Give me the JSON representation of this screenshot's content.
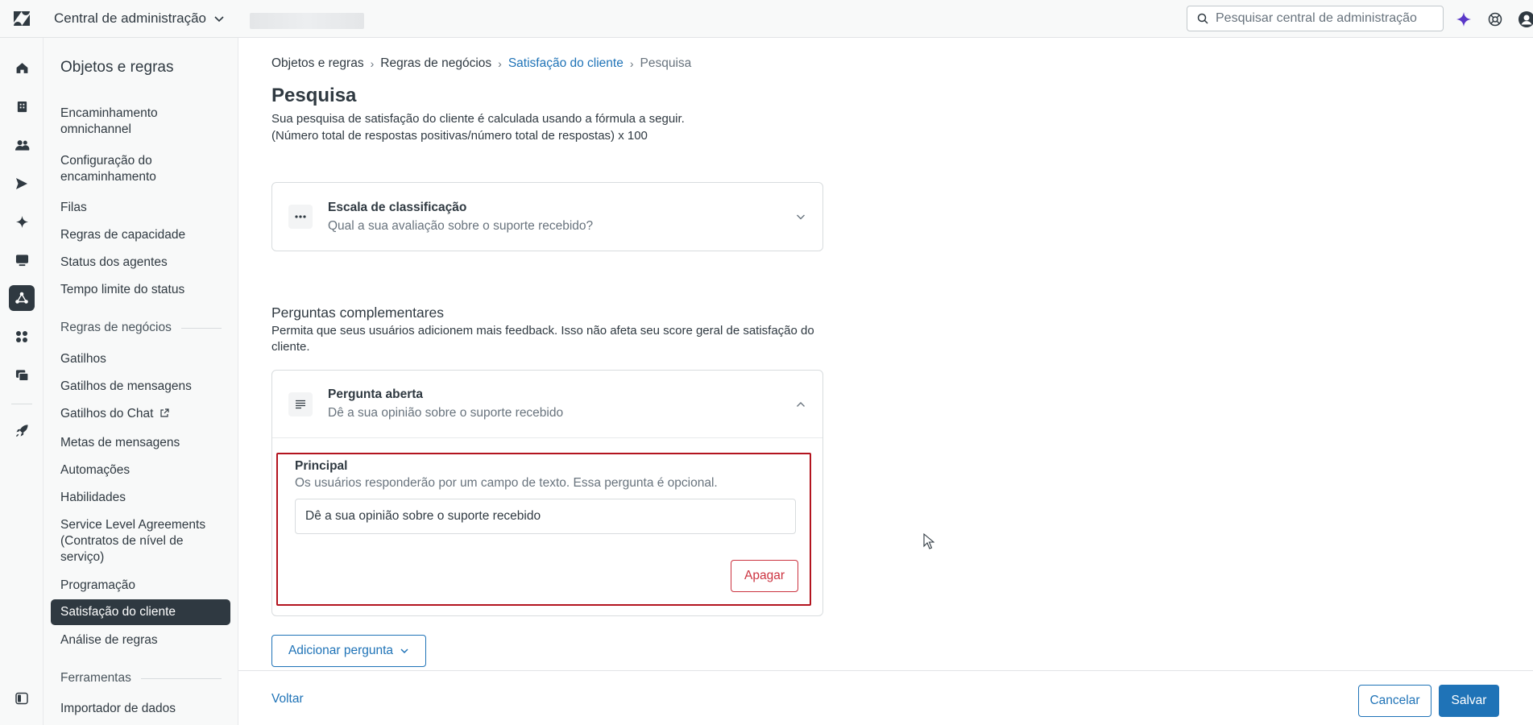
{
  "app": {
    "title": "Central de administração",
    "search_placeholder": "Pesquisar central de administração"
  },
  "colors": {
    "accent": "#1f73b7",
    "danger": "#cc3340",
    "highlight_border": "#b3141f",
    "active_nav": "#2f3941",
    "ai_sparkle": "#5a38c8"
  },
  "subnav": {
    "title": "Objetos e regras",
    "group_routing_items": [
      "Encaminhamento omnichannel",
      "Configuração do encaminhamento",
      "Filas",
      "Regras de capacidade",
      "Status dos agentes",
      "Tempo limite do status"
    ],
    "group_business": "Regras de negócios",
    "business_items": [
      "Gatilhos",
      "Gatilhos de mensagens",
      "Gatilhos do Chat",
      "Metas de mensagens",
      "Automações",
      "Habilidades",
      "Service Level Agreements (Contratos de nível de serviço)",
      "Programação",
      "Satisfação do cliente",
      "Análise de regras"
    ],
    "group_tools": "Ferramentas",
    "tools_items": [
      "Importador de dados"
    ]
  },
  "breadcrumb": [
    "Objetos e regras",
    "Regras de negócios",
    "Satisfação do cliente",
    "Pesquisa"
  ],
  "page": {
    "title": "Pesquisa",
    "description_line1": "Sua pesquisa de satisfação do cliente é calculada usando a fórmula a seguir.",
    "description_line2": "(Número total de respostas positivas/número total de respostas) x 100"
  },
  "rating_card": {
    "title": "Escala de classificação",
    "subtitle": "Qual a sua avaliação sobre o suporte recebido?"
  },
  "followup": {
    "title": "Perguntas complementares",
    "description": "Permita que seus usuários adicionem mais feedback. Isso não afeta seu score geral de satisfação do cliente."
  },
  "open_question": {
    "title": "Pergunta aberta",
    "subtitle": "Dê a sua opinião sobre o suporte recebido",
    "label": "Principal",
    "hint": "Os usuários responderão por um campo de texto. Essa pergunta é opcional.",
    "value": "Dê a sua opinião sobre o suporte recebido",
    "delete_label": "Apagar"
  },
  "add_question_label": "Adicionar pergunta",
  "footer": {
    "back_label": "Voltar",
    "cancel_label": "Cancelar",
    "save_label": "Salvar"
  },
  "icons": {
    "rail": [
      "home-icon",
      "building-icon",
      "people-icon",
      "send-icon",
      "sparkle-icon",
      "monitor-icon",
      "objects-rules-icon",
      "apps-icon",
      "workspaces-icon",
      "rocket-icon",
      "sidebar-toggle-icon"
    ],
    "top": [
      "zendesk-logo-icon",
      "chevron-down-icon",
      "search-icon",
      "ai-sparkle-icon",
      "support-icon",
      "avatar-icon"
    ]
  }
}
